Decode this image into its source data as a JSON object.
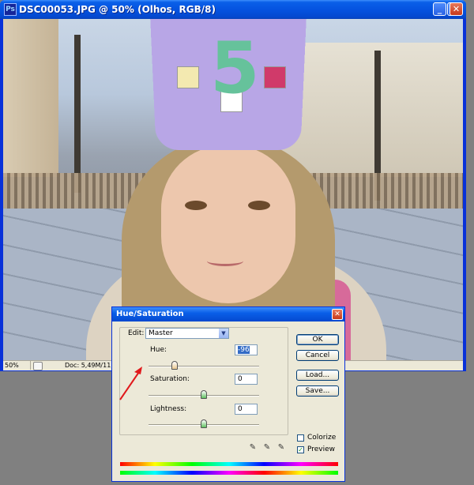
{
  "window": {
    "title": "DSC00053.JPG @ 50% (Olhos, RGB/8)",
    "app_icon": "Ps",
    "buttons": {
      "minimize": "_",
      "maximize": "□",
      "close": "✕"
    }
  },
  "status_bar": {
    "zoom": "50%",
    "doc_info": "Doc: 5,49M/11,2M"
  },
  "hat_number": "5",
  "dialog": {
    "title": "Hue/Saturation",
    "close": "✕",
    "edit_label": "Edit:",
    "edit_value": "Master",
    "hue_label": "Hue:",
    "hue_value": "-96",
    "saturation_label": "Saturation:",
    "saturation_value": "0",
    "lightness_label": "Lightness:",
    "lightness_value": "0",
    "sliders": {
      "hue": {
        "value": -96,
        "min": -180,
        "max": 180
      },
      "saturation": {
        "value": 0,
        "min": -100,
        "max": 100
      },
      "lightness": {
        "value": 0,
        "min": -100,
        "max": 100
      }
    },
    "buttons": {
      "ok": "OK",
      "cancel": "Cancel",
      "load": "Load...",
      "save": "Save..."
    },
    "colorize_label": "Colorize",
    "colorize_checked": false,
    "preview_label": "Preview",
    "preview_checked": true,
    "eyedropper_icons": [
      "eyedropper-icon",
      "eyedropper-plus-icon",
      "eyedropper-minus-icon"
    ]
  },
  "annotation_color": "#e0191c"
}
